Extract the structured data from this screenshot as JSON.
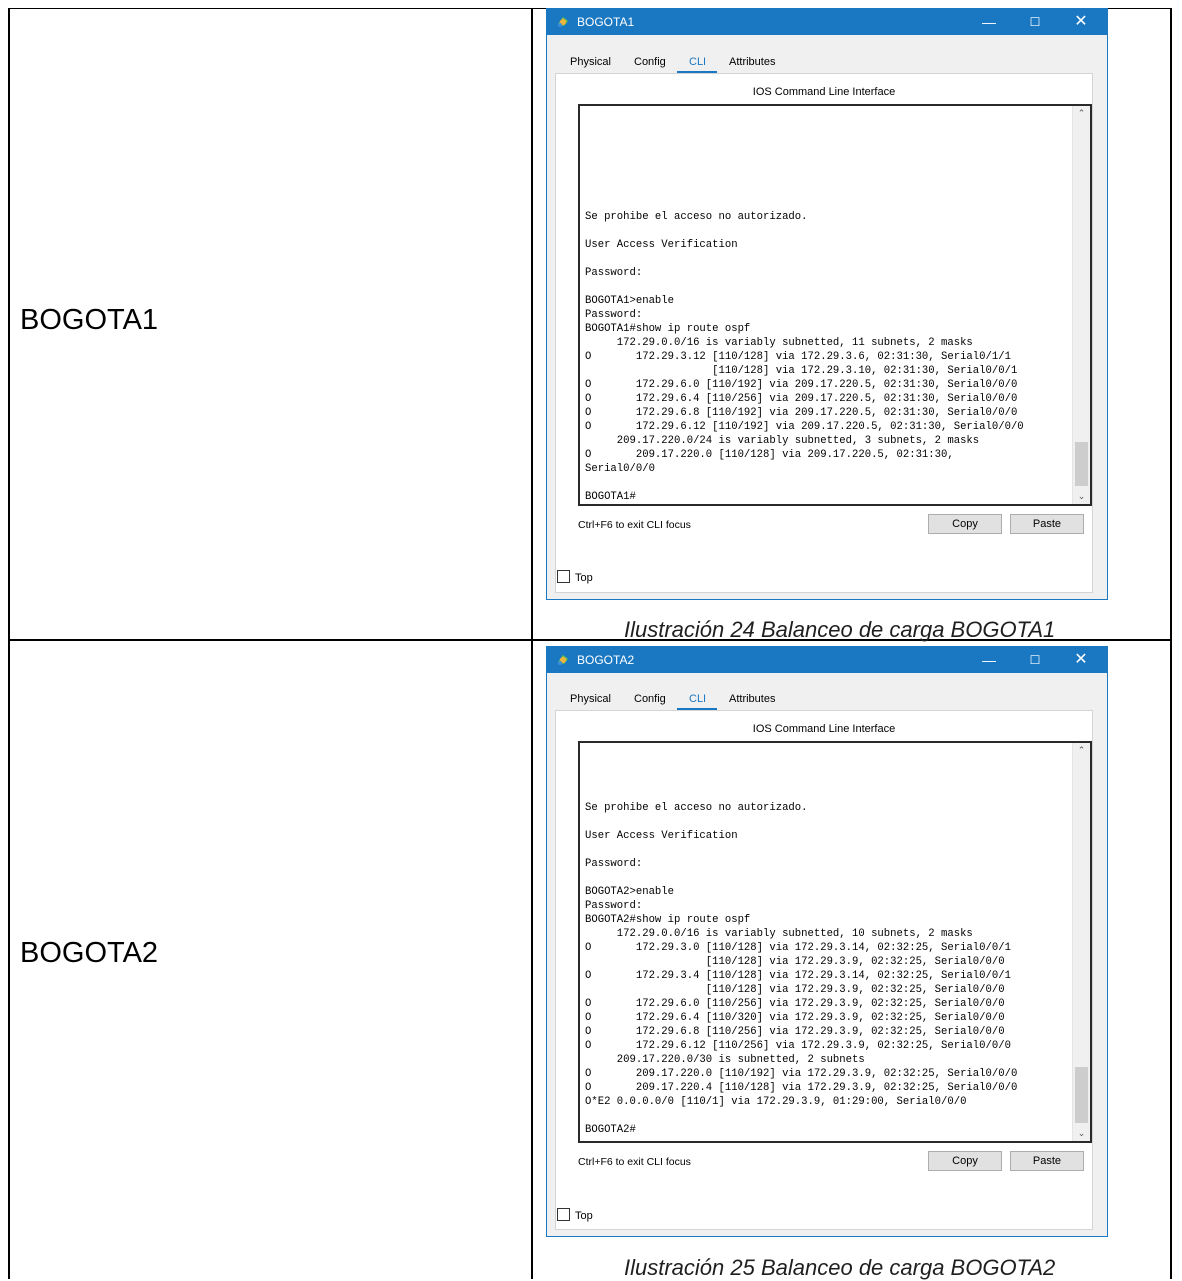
{
  "rows": [
    {
      "label": "BOGOTA1",
      "window": {
        "title": "BOGOTA1",
        "tabs": [
          "Physical",
          "Config",
          "CLI",
          "Attributes"
        ],
        "active_tab": "CLI",
        "cli_header": "IOS Command Line Interface",
        "cli_text": "Se prohibe el acceso no autorizado.\n\nUser Access Verification\n\nPassword:\n\nBOGOTA1>enable\nPassword:\nBOGOTA1#show ip route ospf\n     172.29.0.0/16 is variably subnetted, 11 subnets, 2 masks\nO       172.29.3.12 [110/128] via 172.29.3.6, 02:31:30, Serial0/1/1\n                    [110/128] via 172.29.3.10, 02:31:30, Serial0/0/1\nO       172.29.6.0 [110/192] via 209.17.220.5, 02:31:30, Serial0/0/0\nO       172.29.6.4 [110/256] via 209.17.220.5, 02:31:30, Serial0/0/0\nO       172.29.6.8 [110/192] via 209.17.220.5, 02:31:30, Serial0/0/0\nO       172.29.6.12 [110/192] via 209.17.220.5, 02:31:30, Serial0/0/0\n     209.17.220.0/24 is variably subnetted, 3 subnets, 2 masks\nO       209.17.220.0 [110/128] via 209.17.220.5, 02:31:30,\nSerial0/0/0\n\nBOGOTA1#",
        "hint": "Ctrl+F6 to exit CLI focus",
        "copy_label": "Copy",
        "paste_label": "Paste",
        "top_label": "Top"
      },
      "caption": "Ilustración 24 Balanceo de carga BOGOTA1"
    },
    {
      "label": "BOGOTA2",
      "window": {
        "title": "BOGOTA2",
        "tabs": [
          "Physical",
          "Config",
          "CLI",
          "Attributes"
        ],
        "active_tab": "CLI",
        "cli_header": "IOS Command Line Interface",
        "cli_text": "Se prohibe el acceso no autorizado.\n\nUser Access Verification\n\nPassword:\n\nBOGOTA2>enable\nPassword:\nBOGOTA2#show ip route ospf\n     172.29.0.0/16 is variably subnetted, 10 subnets, 2 masks\nO       172.29.3.0 [110/128] via 172.29.3.14, 02:32:25, Serial0/0/1\n                   [110/128] via 172.29.3.9, 02:32:25, Serial0/0/0\nO       172.29.3.4 [110/128] via 172.29.3.14, 02:32:25, Serial0/0/1\n                   [110/128] via 172.29.3.9, 02:32:25, Serial0/0/0\nO       172.29.6.0 [110/256] via 172.29.3.9, 02:32:25, Serial0/0/0\nO       172.29.6.4 [110/320] via 172.29.3.9, 02:32:25, Serial0/0/0\nO       172.29.6.8 [110/256] via 172.29.3.9, 02:32:25, Serial0/0/0\nO       172.29.6.12 [110/256] via 172.29.3.9, 02:32:25, Serial0/0/0\n     209.17.220.0/30 is subnetted, 2 subnets\nO       209.17.220.0 [110/192] via 172.29.3.9, 02:32:25, Serial0/0/0\nO       209.17.220.4 [110/128] via 172.29.3.9, 02:32:25, Serial0/0/0\nO*E2 0.0.0.0/0 [110/1] via 172.29.3.9, 01:29:00, Serial0/0/0\n\nBOGOTA2#",
        "hint": "Ctrl+F6 to exit CLI focus",
        "copy_label": "Copy",
        "paste_label": "Paste",
        "top_label": "Top"
      },
      "caption": "Ilustración 25 Balanceo de carga BOGOTA2"
    }
  ]
}
